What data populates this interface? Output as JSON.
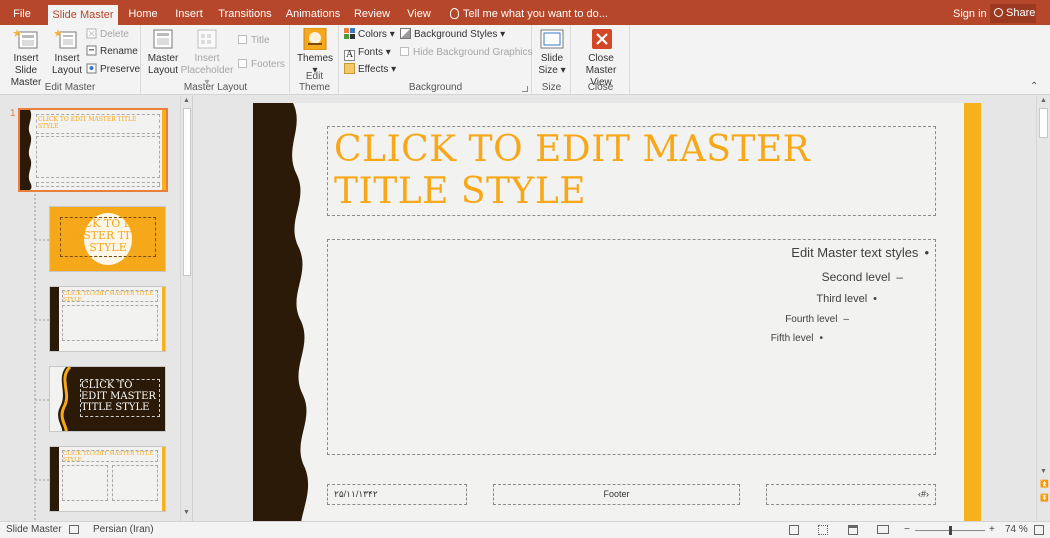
{
  "tabs": [
    "File",
    "Slide Master",
    "Home",
    "Insert",
    "Transitions",
    "Animations",
    "Review",
    "View"
  ],
  "active_tab": "Slide Master",
  "tell_me": "Tell me what you want to do...",
  "sign_in": "Sign in",
  "share": "Share",
  "ribbon": {
    "edit_master": {
      "label": "Edit Master",
      "insert_slide_master": "Insert Slide Master",
      "insert_layout": "Insert Layout",
      "delete": "Delete",
      "rename": "Rename",
      "preserve": "Preserve"
    },
    "master_layout": {
      "label": "Master Layout",
      "master_layout": "Master Layout",
      "insert_placeholder": "Insert Placeholder",
      "title": "Title",
      "footers": "Footers"
    },
    "edit_theme": {
      "label": "Edit Theme",
      "themes": "Themes"
    },
    "background": {
      "label": "Background",
      "colors": "Colors",
      "fonts": "Fonts",
      "effects": "Effects",
      "background_styles": "Background Styles",
      "hide_background_graphics": "Hide Background Graphics"
    },
    "size": {
      "label": "Size",
      "slide_size": "Slide Size"
    },
    "close": {
      "label": "Close",
      "close_master_view": "Close Master View"
    }
  },
  "thumbnails": {
    "slide_number": "1",
    "t1_title": "CLICK TO EDIT MASTER TITLE STYLE",
    "t2_title": "CLICK TO EDIT MASTER TITLE STYLE",
    "t3_title": "CLICK TO EDIT MASTER TITLE STYLE",
    "t4_title": "CLICK TO EDIT MASTER TITLE STYLE",
    "t5_title": "CLICK TO EDIT MASTER TITLE STYLE"
  },
  "slide": {
    "title": "CLICK TO EDIT MASTER TITLE STYLE",
    "levels": [
      "Edit Master text styles",
      "Second level",
      "Third level",
      "Fourth level",
      "Fifth level"
    ],
    "bullets": [
      "•",
      "–",
      "•",
      "–",
      "•"
    ],
    "date": "۲۵/۱۱/۱۳۴۲",
    "footer": "Footer",
    "slide_num": "‹#›"
  },
  "status": {
    "view": "Slide Master",
    "language": "Persian (Iran)",
    "zoom": "74 %",
    "zoom_fraction": 0.5
  },
  "colors": {
    "ribbon_accent": "#b7472a",
    "title_orange": "#f7a718",
    "dark_brown": "#2b1a07",
    "selection_orange": "#e8803c"
  }
}
